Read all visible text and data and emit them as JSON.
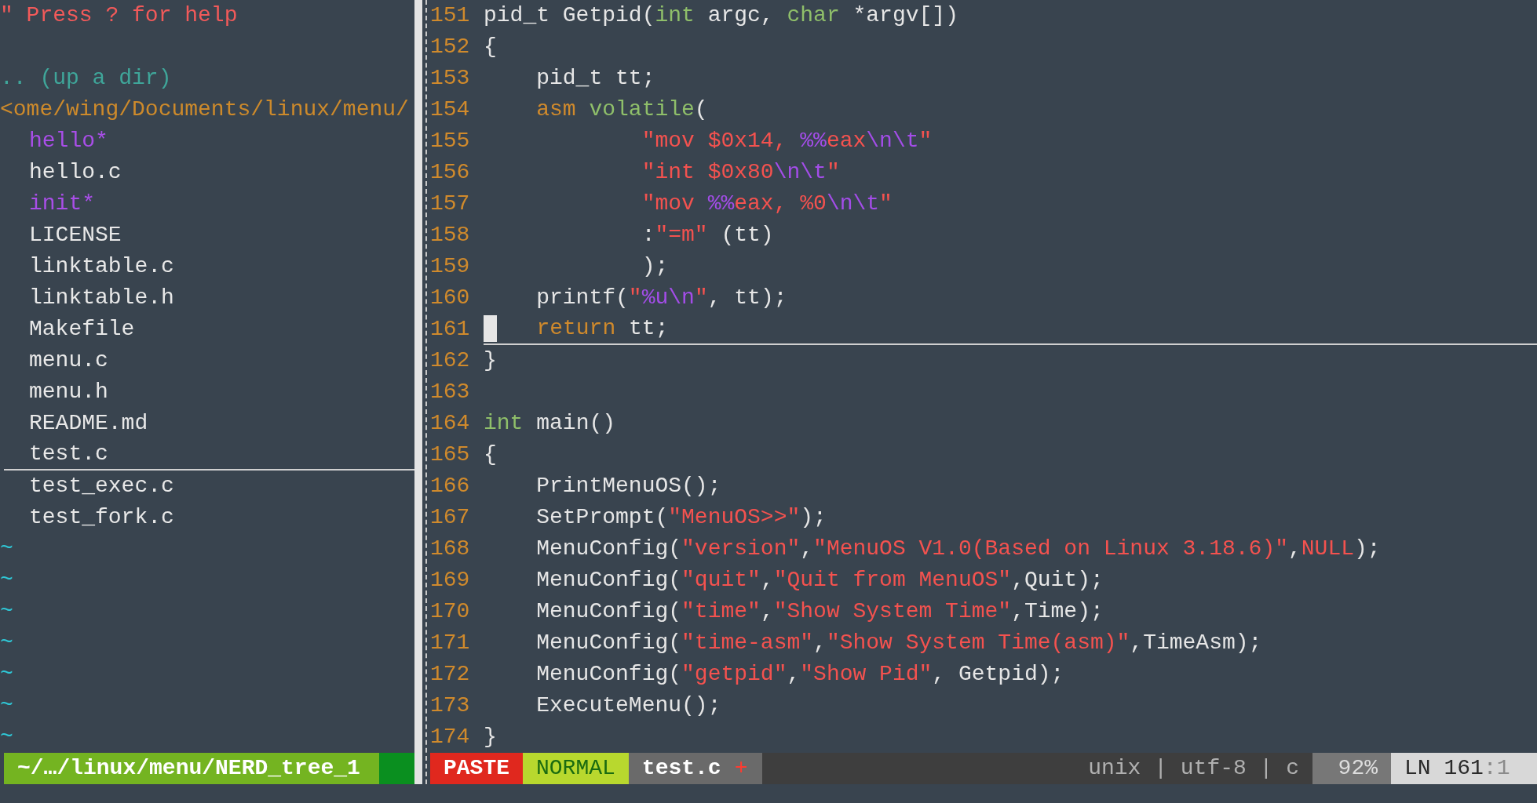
{
  "file_tree": {
    "help": "\" Press ? for help",
    "up_dir": ".. (up a dir)",
    "root": "<ome/wing/Documents/linux/menu/",
    "entries": [
      {
        "name": "hello*",
        "kind": "executable",
        "selected": false
      },
      {
        "name": "hello.c",
        "kind": "file",
        "selected": false
      },
      {
        "name": "init*",
        "kind": "executable",
        "selected": false
      },
      {
        "name": "LICENSE",
        "kind": "file",
        "selected": false
      },
      {
        "name": "linktable.c",
        "kind": "file",
        "selected": false
      },
      {
        "name": "linktable.h",
        "kind": "file",
        "selected": false
      },
      {
        "name": "Makefile",
        "kind": "file",
        "selected": false
      },
      {
        "name": "menu.c",
        "kind": "file",
        "selected": false
      },
      {
        "name": "menu.h",
        "kind": "file",
        "selected": false
      },
      {
        "name": "README.md",
        "kind": "file",
        "selected": false
      },
      {
        "name": "test.c",
        "kind": "file",
        "selected": true
      },
      {
        "name": "test_exec.c",
        "kind": "file",
        "selected": false
      },
      {
        "name": "test_fork.c",
        "kind": "file",
        "selected": false
      }
    ],
    "end_markers": [
      "~",
      "~",
      "~",
      "~",
      "~",
      "~",
      "~"
    ]
  },
  "editor": {
    "lines": [
      {
        "number": "151",
        "current": false,
        "tokens": [
          {
            "text": "pid_t Getpid(",
            "kind": "plain"
          },
          {
            "text": "int",
            "kind": "type"
          },
          {
            "text": " argc, ",
            "kind": "plain"
          },
          {
            "text": "char",
            "kind": "type"
          },
          {
            "text": " *argv[])",
            "kind": "plain"
          }
        ]
      },
      {
        "number": "152",
        "current": false,
        "tokens": [
          {
            "text": "{",
            "kind": "plain"
          }
        ]
      },
      {
        "number": "153",
        "current": false,
        "tokens": [
          {
            "text": "    pid_t tt;",
            "kind": "plain"
          }
        ]
      },
      {
        "number": "154",
        "current": false,
        "tokens": [
          {
            "text": "    asm",
            "kind": "keyword"
          },
          {
            "text": " volatile",
            "kind": "type"
          },
          {
            "text": "(",
            "kind": "plain"
          }
        ]
      },
      {
        "number": "155",
        "current": false,
        "tokens": [
          {
            "text": "            \"mov $0x14, ",
            "kind": "string"
          },
          {
            "text": "%%",
            "kind": "escape"
          },
          {
            "text": "eax",
            "kind": "string"
          },
          {
            "text": "\\n\\t",
            "kind": "escape"
          },
          {
            "text": "\"",
            "kind": "string"
          }
        ]
      },
      {
        "number": "156",
        "current": false,
        "tokens": [
          {
            "text": "            \"int $0x80",
            "kind": "string"
          },
          {
            "text": "\\n\\t",
            "kind": "escape"
          },
          {
            "text": "\"",
            "kind": "string"
          }
        ]
      },
      {
        "number": "157",
        "current": false,
        "tokens": [
          {
            "text": "            \"mov ",
            "kind": "string"
          },
          {
            "text": "%%",
            "kind": "escape"
          },
          {
            "text": "eax, %0",
            "kind": "string"
          },
          {
            "text": "\\n\\t",
            "kind": "escape"
          },
          {
            "text": "\"",
            "kind": "string"
          }
        ]
      },
      {
        "number": "158",
        "current": false,
        "tokens": [
          {
            "text": "            :",
            "kind": "plain"
          },
          {
            "text": "\"=m\"",
            "kind": "string"
          },
          {
            "text": " (tt)",
            "kind": "plain"
          }
        ]
      },
      {
        "number": "159",
        "current": false,
        "tokens": [
          {
            "text": "            );",
            "kind": "plain"
          }
        ]
      },
      {
        "number": "160",
        "current": false,
        "tokens": [
          {
            "text": "    printf(",
            "kind": "plain"
          },
          {
            "text": "\"",
            "kind": "string"
          },
          {
            "text": "%u\\n",
            "kind": "escape"
          },
          {
            "text": "\"",
            "kind": "string"
          },
          {
            "text": ", tt);",
            "kind": "plain"
          }
        ]
      },
      {
        "number": "161",
        "current": true,
        "tokens": [
          {
            "text": "   return",
            "kind": "keyword"
          },
          {
            "text": " tt;",
            "kind": "plain"
          }
        ]
      },
      {
        "number": "162",
        "current": false,
        "tokens": [
          {
            "text": "}",
            "kind": "plain"
          }
        ]
      },
      {
        "number": "163",
        "current": false
      },
      {
        "number": "164",
        "current": false,
        "tokens": [
          {
            "text": "int",
            "kind": "type"
          },
          {
            "text": " main()",
            "kind": "plain"
          }
        ]
      },
      {
        "number": "165",
        "current": false,
        "tokens": [
          {
            "text": "{",
            "kind": "plain"
          }
        ]
      },
      {
        "number": "166",
        "current": false,
        "tokens": [
          {
            "text": "    PrintMenuOS();",
            "kind": "plain"
          }
        ]
      },
      {
        "number": "167",
        "current": false,
        "tokens": [
          {
            "text": "    SetPrompt(",
            "kind": "plain"
          },
          {
            "text": "\"MenuOS>>\"",
            "kind": "string"
          },
          {
            "text": ");",
            "kind": "plain"
          }
        ]
      },
      {
        "number": "168",
        "current": false,
        "tokens": [
          {
            "text": "    MenuConfig(",
            "kind": "plain"
          },
          {
            "text": "\"version\"",
            "kind": "string"
          },
          {
            "text": ",",
            "kind": "plain"
          },
          {
            "text": "\"MenuOS V1.0(Based on Linux 3.18.6)\"",
            "kind": "string"
          },
          {
            "text": ",",
            "kind": "plain"
          },
          {
            "text": "NULL",
            "kind": "constant"
          },
          {
            "text": ");",
            "kind": "plain"
          }
        ]
      },
      {
        "number": "169",
        "current": false,
        "tokens": [
          {
            "text": "    MenuConfig(",
            "kind": "plain"
          },
          {
            "text": "\"quit\"",
            "kind": "string"
          },
          {
            "text": ",",
            "kind": "plain"
          },
          {
            "text": "\"Quit from MenuOS\"",
            "kind": "string"
          },
          {
            "text": ",Quit);",
            "kind": "plain"
          }
        ]
      },
      {
        "number": "170",
        "current": false,
        "tokens": [
          {
            "text": "    MenuConfig(",
            "kind": "plain"
          },
          {
            "text": "\"time\"",
            "kind": "string"
          },
          {
            "text": ",",
            "kind": "plain"
          },
          {
            "text": "\"Show System Time\"",
            "kind": "string"
          },
          {
            "text": ",Time);",
            "kind": "plain"
          }
        ]
      },
      {
        "number": "171",
        "current": false,
        "tokens": [
          {
            "text": "    MenuConfig(",
            "kind": "plain"
          },
          {
            "text": "\"time-asm\"",
            "kind": "string"
          },
          {
            "text": ",",
            "kind": "plain"
          },
          {
            "text": "\"Show System Time(asm)\"",
            "kind": "string"
          },
          {
            "text": ",TimeAsm);",
            "kind": "plain"
          }
        ]
      },
      {
        "number": "172",
        "current": false,
        "tokens": [
          {
            "text": "    MenuConfig(",
            "kind": "plain"
          },
          {
            "text": "\"getpid\"",
            "kind": "string"
          },
          {
            "text": ",",
            "kind": "plain"
          },
          {
            "text": "\"Show Pid\"",
            "kind": "string"
          },
          {
            "text": ", Getpid);",
            "kind": "plain"
          }
        ]
      },
      {
        "number": "173",
        "current": false,
        "tokens": [
          {
            "text": "    ExecuteMenu();",
            "kind": "plain"
          }
        ]
      },
      {
        "number": "174",
        "current": false,
        "tokens": [
          {
            "text": "}",
            "kind": "plain"
          }
        ]
      }
    ]
  },
  "tree_status": "~/…/linux/menu/NERD_tree_1",
  "status_line": [
    {
      "kind": "paste",
      "text": "PASTE"
    },
    {
      "kind": "mode",
      "text": "NORMAL"
    },
    {
      "kind": "file",
      "text": "test.c",
      "modified": "+"
    },
    {
      "kind": "info",
      "text": "unix | utf-8 | c"
    },
    {
      "kind": "percent",
      "text": "92%"
    },
    {
      "kind": "position",
      "text": "LN 161",
      "column": ":1"
    }
  ]
}
